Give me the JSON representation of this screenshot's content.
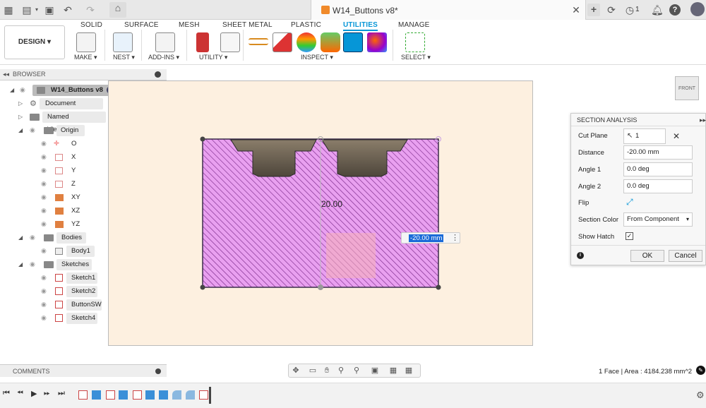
{
  "doc_tab": {
    "title": "W14_Buttons v8*"
  },
  "titlebar": {
    "job_count": "1"
  },
  "workspace": {
    "label": "DESIGN ▾"
  },
  "ribbon": {
    "tabs": [
      "SOLID",
      "SURFACE",
      "MESH",
      "SHEET METAL",
      "PLASTIC",
      "UTILITIES",
      "MANAGE"
    ],
    "active_tab": "UTILITIES",
    "groups": {
      "make": "MAKE ▾",
      "nest": "NEST ▾",
      "addins": "ADD-INS ▾",
      "utility": "UTILITY ▾",
      "inspect": "INSPECT ▾",
      "select": "SELECT ▾"
    }
  },
  "browser": {
    "title": "BROWSER",
    "items": [
      {
        "label": "W14_Buttons v8"
      },
      {
        "label": "Document Settings"
      },
      {
        "label": "Named Views"
      },
      {
        "label": "Origin"
      },
      {
        "label": "O"
      },
      {
        "label": "X"
      },
      {
        "label": "Y"
      },
      {
        "label": "Z"
      },
      {
        "label": "XY"
      },
      {
        "label": "XZ"
      },
      {
        "label": "YZ"
      },
      {
        "label": "Bodies"
      },
      {
        "label": "Body1"
      },
      {
        "label": "Sketches"
      },
      {
        "label": "Sketch1"
      },
      {
        "label": "Sketch2"
      },
      {
        "label": "ButtonSW"
      },
      {
        "label": "Sketch4"
      }
    ]
  },
  "viewport": {
    "dimension_label": "20.00",
    "distance_input": "-20.00 mm",
    "viewcube_face": "FRONT"
  },
  "section_panel": {
    "title": "SECTION ANALYSIS",
    "cut_plane_label": "Cut Plane",
    "cut_plane_value": "1 selected",
    "distance_label": "Distance",
    "distance_value": "-20.00 mm",
    "angle1_label": "Angle 1",
    "angle1_value": "0.0 deg",
    "angle2_label": "Angle 2",
    "angle2_value": "0.0 deg",
    "flip_label": "Flip",
    "section_color_label": "Section Color",
    "section_color_value": "From Component",
    "show_hatch_label": "Show Hatch",
    "ok_label": "OK",
    "cancel_label": "Cancel"
  },
  "comments": {
    "title": "COMMENTS"
  },
  "status": {
    "text": "1 Face | Area : 4184.238 mm^2"
  },
  "colors": {
    "accent": "#0696d7",
    "section_fill": "#e9a0f0",
    "hatch": "#7a2a8a",
    "canvas_bg": "#fdf0e0"
  }
}
